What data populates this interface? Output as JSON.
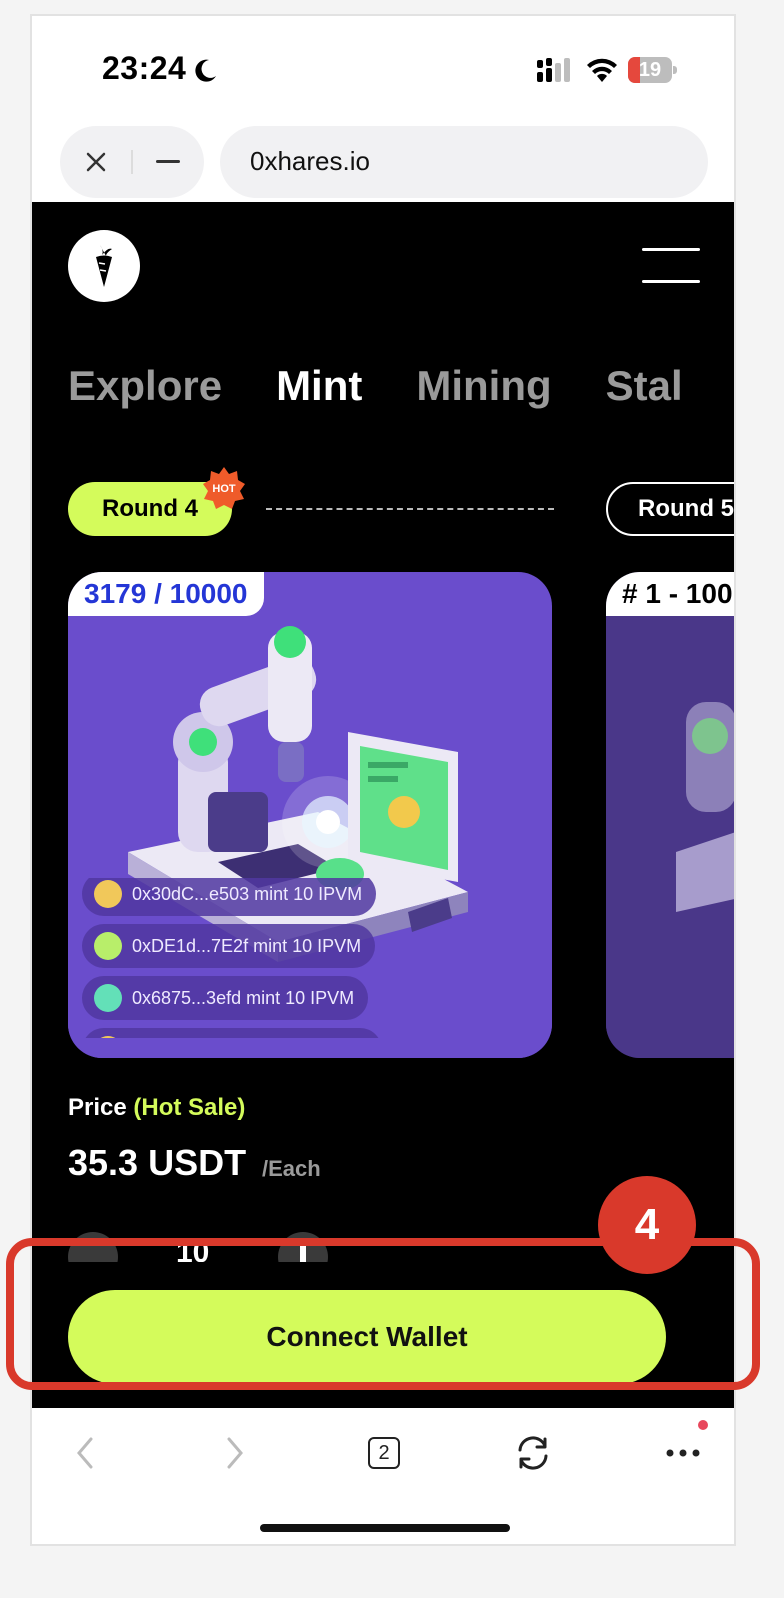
{
  "status_bar": {
    "time": "23:24",
    "battery_level": "19",
    "icons": [
      "moon-icon",
      "cellular-signal-icon",
      "wifi-icon",
      "battery-icon"
    ]
  },
  "browser": {
    "url": "0xhares.io",
    "tab_count": "2",
    "toolbar_icons": [
      "back-icon",
      "forward-icon",
      "tabs-icon",
      "refresh-icon",
      "more-icon"
    ]
  },
  "site": {
    "nav": [
      "Explore",
      "Mint",
      "Mining",
      "Stal"
    ],
    "active_nav": "Mint",
    "rounds": {
      "current": "Round 4",
      "current_badge": "HOT",
      "next": "Round 5"
    },
    "card_main": {
      "counter": "3179 / 10000",
      "feed": [
        "0x30dC...e503 mint 10 IPVM",
        "0xDE1d...7E2f mint 10 IPVM",
        "0x6875...3efd mint 10 IPVM"
      ]
    },
    "card_next": {
      "label": "# 1 - 100"
    },
    "price": {
      "label": "Price",
      "tag": "(Hot Sale)",
      "value": "35.3 USDT",
      "unit": "/Each"
    },
    "quantity": "10",
    "connect_button": "Connect Wallet"
  },
  "annotation": {
    "step": "4",
    "color": "#d9392b"
  },
  "colors": {
    "accent": "#d4fb5b",
    "card_bg": "#6a4dcc",
    "counter_text": "#2436d6"
  }
}
